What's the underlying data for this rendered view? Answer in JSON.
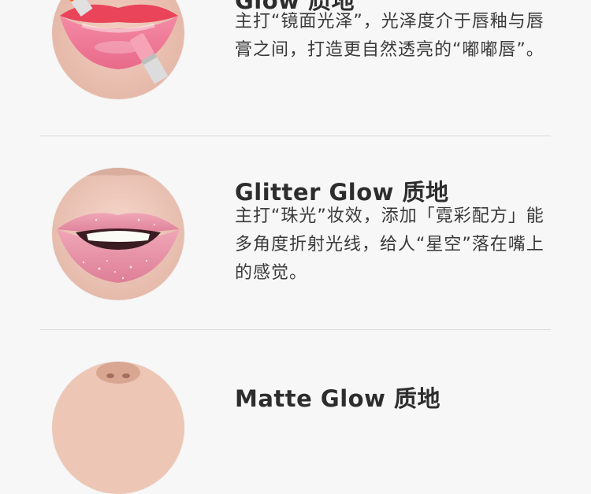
{
  "items": [
    {
      "title": "Glow 质地",
      "description": "主打“镜面光泽”，光泽度介于唇釉与唇膏之间，打造更自然透亮的“嘟嘟唇”。"
    },
    {
      "title": "Glitter Glow 质地",
      "description": "主打“珠光”妆效，添加「霓彩配方」能多角度折射光线，给人“星空”落在嘴上的感觉。"
    },
    {
      "title": "Matte Glow 质地",
      "description": ""
    }
  ]
}
